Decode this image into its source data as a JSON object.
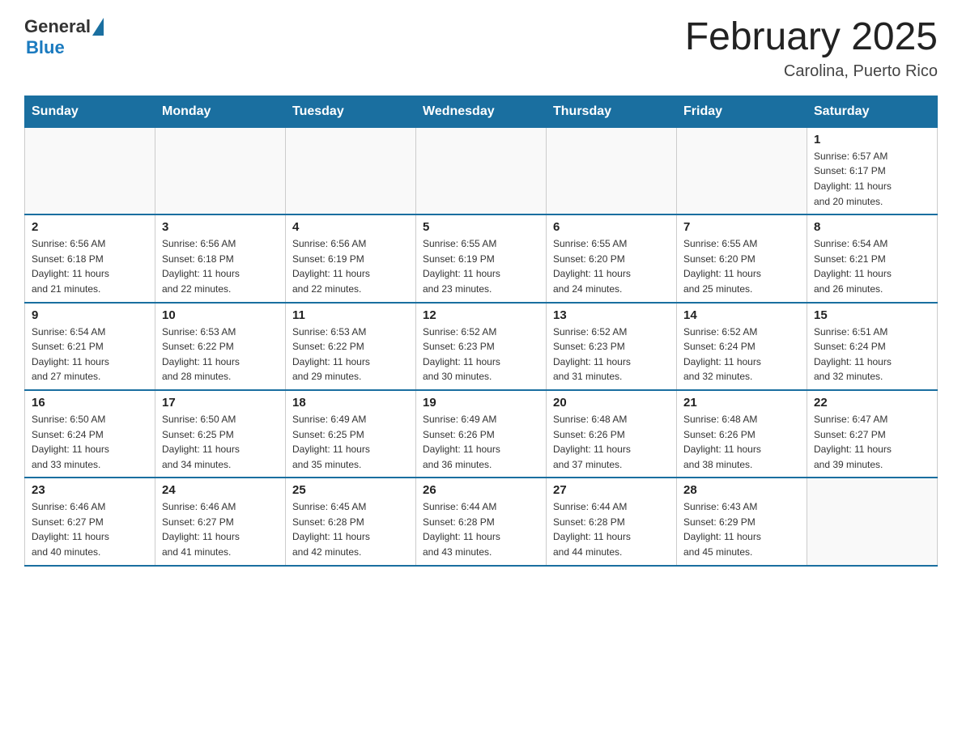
{
  "header": {
    "logo_general": "General",
    "logo_blue": "Blue",
    "title": "February 2025",
    "subtitle": "Carolina, Puerto Rico"
  },
  "weekdays": [
    "Sunday",
    "Monday",
    "Tuesday",
    "Wednesday",
    "Thursday",
    "Friday",
    "Saturday"
  ],
  "weeks": [
    [
      {
        "day": "",
        "info": ""
      },
      {
        "day": "",
        "info": ""
      },
      {
        "day": "",
        "info": ""
      },
      {
        "day": "",
        "info": ""
      },
      {
        "day": "",
        "info": ""
      },
      {
        "day": "",
        "info": ""
      },
      {
        "day": "1",
        "info": "Sunrise: 6:57 AM\nSunset: 6:17 PM\nDaylight: 11 hours\nand 20 minutes."
      }
    ],
    [
      {
        "day": "2",
        "info": "Sunrise: 6:56 AM\nSunset: 6:18 PM\nDaylight: 11 hours\nand 21 minutes."
      },
      {
        "day": "3",
        "info": "Sunrise: 6:56 AM\nSunset: 6:18 PM\nDaylight: 11 hours\nand 22 minutes."
      },
      {
        "day": "4",
        "info": "Sunrise: 6:56 AM\nSunset: 6:19 PM\nDaylight: 11 hours\nand 22 minutes."
      },
      {
        "day": "5",
        "info": "Sunrise: 6:55 AM\nSunset: 6:19 PM\nDaylight: 11 hours\nand 23 minutes."
      },
      {
        "day": "6",
        "info": "Sunrise: 6:55 AM\nSunset: 6:20 PM\nDaylight: 11 hours\nand 24 minutes."
      },
      {
        "day": "7",
        "info": "Sunrise: 6:55 AM\nSunset: 6:20 PM\nDaylight: 11 hours\nand 25 minutes."
      },
      {
        "day": "8",
        "info": "Sunrise: 6:54 AM\nSunset: 6:21 PM\nDaylight: 11 hours\nand 26 minutes."
      }
    ],
    [
      {
        "day": "9",
        "info": "Sunrise: 6:54 AM\nSunset: 6:21 PM\nDaylight: 11 hours\nand 27 minutes."
      },
      {
        "day": "10",
        "info": "Sunrise: 6:53 AM\nSunset: 6:22 PM\nDaylight: 11 hours\nand 28 minutes."
      },
      {
        "day": "11",
        "info": "Sunrise: 6:53 AM\nSunset: 6:22 PM\nDaylight: 11 hours\nand 29 minutes."
      },
      {
        "day": "12",
        "info": "Sunrise: 6:52 AM\nSunset: 6:23 PM\nDaylight: 11 hours\nand 30 minutes."
      },
      {
        "day": "13",
        "info": "Sunrise: 6:52 AM\nSunset: 6:23 PM\nDaylight: 11 hours\nand 31 minutes."
      },
      {
        "day": "14",
        "info": "Sunrise: 6:52 AM\nSunset: 6:24 PM\nDaylight: 11 hours\nand 32 minutes."
      },
      {
        "day": "15",
        "info": "Sunrise: 6:51 AM\nSunset: 6:24 PM\nDaylight: 11 hours\nand 32 minutes."
      }
    ],
    [
      {
        "day": "16",
        "info": "Sunrise: 6:50 AM\nSunset: 6:24 PM\nDaylight: 11 hours\nand 33 minutes."
      },
      {
        "day": "17",
        "info": "Sunrise: 6:50 AM\nSunset: 6:25 PM\nDaylight: 11 hours\nand 34 minutes."
      },
      {
        "day": "18",
        "info": "Sunrise: 6:49 AM\nSunset: 6:25 PM\nDaylight: 11 hours\nand 35 minutes."
      },
      {
        "day": "19",
        "info": "Sunrise: 6:49 AM\nSunset: 6:26 PM\nDaylight: 11 hours\nand 36 minutes."
      },
      {
        "day": "20",
        "info": "Sunrise: 6:48 AM\nSunset: 6:26 PM\nDaylight: 11 hours\nand 37 minutes."
      },
      {
        "day": "21",
        "info": "Sunrise: 6:48 AM\nSunset: 6:26 PM\nDaylight: 11 hours\nand 38 minutes."
      },
      {
        "day": "22",
        "info": "Sunrise: 6:47 AM\nSunset: 6:27 PM\nDaylight: 11 hours\nand 39 minutes."
      }
    ],
    [
      {
        "day": "23",
        "info": "Sunrise: 6:46 AM\nSunset: 6:27 PM\nDaylight: 11 hours\nand 40 minutes."
      },
      {
        "day": "24",
        "info": "Sunrise: 6:46 AM\nSunset: 6:27 PM\nDaylight: 11 hours\nand 41 minutes."
      },
      {
        "day": "25",
        "info": "Sunrise: 6:45 AM\nSunset: 6:28 PM\nDaylight: 11 hours\nand 42 minutes."
      },
      {
        "day": "26",
        "info": "Sunrise: 6:44 AM\nSunset: 6:28 PM\nDaylight: 11 hours\nand 43 minutes."
      },
      {
        "day": "27",
        "info": "Sunrise: 6:44 AM\nSunset: 6:28 PM\nDaylight: 11 hours\nand 44 minutes."
      },
      {
        "day": "28",
        "info": "Sunrise: 6:43 AM\nSunset: 6:29 PM\nDaylight: 11 hours\nand 45 minutes."
      },
      {
        "day": "",
        "info": ""
      }
    ]
  ]
}
